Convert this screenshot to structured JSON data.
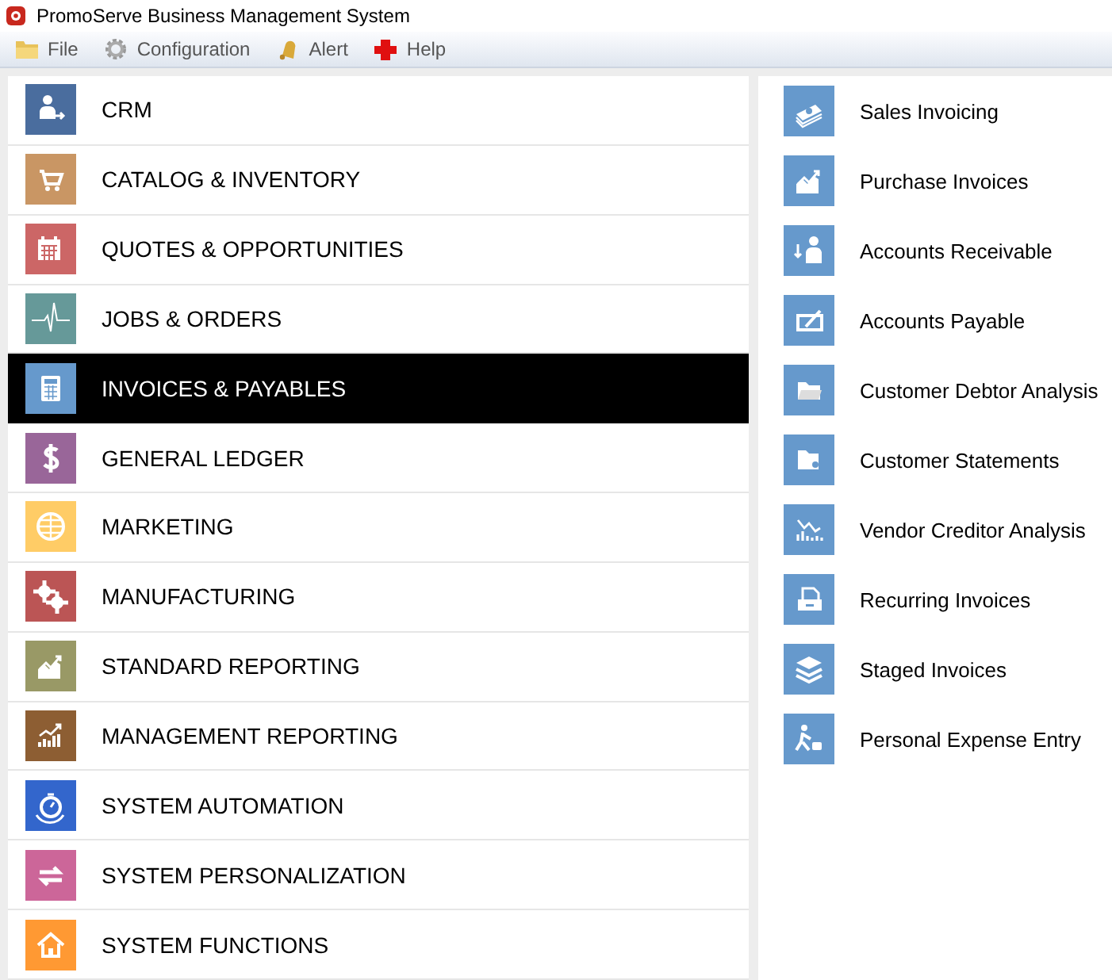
{
  "window": {
    "title": "PromoServe Business Management System"
  },
  "menu": [
    {
      "label": "File"
    },
    {
      "label": "Configuration"
    },
    {
      "label": "Alert"
    },
    {
      "label": "Help"
    }
  ],
  "modules": [
    {
      "label": "CRM",
      "color": "#4a6d9e",
      "selected": false
    },
    {
      "label": "CATALOG & INVENTORY",
      "color": "#c99664",
      "selected": false
    },
    {
      "label": "QUOTES & OPPORTUNITIES",
      "color": "#cc6666",
      "selected": false
    },
    {
      "label": "JOBS & ORDERS",
      "color": "#669999",
      "selected": false
    },
    {
      "label": "INVOICES & PAYABLES",
      "color": "#6699cc",
      "selected": true
    },
    {
      "label": "GENERAL LEDGER",
      "color": "#996699",
      "selected": false
    },
    {
      "label": "MARKETING",
      "color": "#ffcc66",
      "selected": false
    },
    {
      "label": "MANUFACTURING",
      "color": "#bb5555",
      "selected": false
    },
    {
      "label": "STANDARD REPORTING",
      "color": "#999966",
      "selected": false
    },
    {
      "label": "MANAGEMENT REPORTING",
      "color": "#8d5e33",
      "selected": false
    },
    {
      "label": "SYSTEM AUTOMATION",
      "color": "#3366cc",
      "selected": false
    },
    {
      "label": "SYSTEM PERSONALIZATION",
      "color": "#cc6699",
      "selected": false
    },
    {
      "label": "SYSTEM FUNCTIONS",
      "color": "#ff9933",
      "selected": false
    }
  ],
  "functions": [
    {
      "label": "Sales Invoicing"
    },
    {
      "label": "Purchase Invoices"
    },
    {
      "label": "Accounts Receivable"
    },
    {
      "label": "Accounts Payable"
    },
    {
      "label": "Customer Debtor Analysis"
    },
    {
      "label": "Customer Statements"
    },
    {
      "label": "Vendor Creditor Analysis"
    },
    {
      "label": "Recurring Invoices"
    },
    {
      "label": "Staged Invoices"
    },
    {
      "label": "Personal Expense Entry"
    }
  ]
}
